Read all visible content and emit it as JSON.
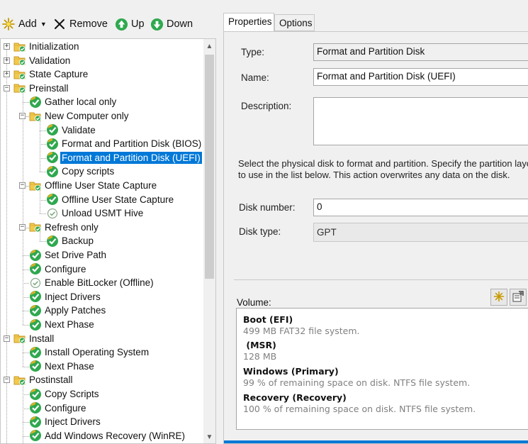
{
  "toolbar": {
    "add_label": "Add",
    "remove_label": "Remove",
    "up_label": "Up",
    "down_label": "Down"
  },
  "tree": {
    "items": [
      {
        "label": "Initialization",
        "icon": "folder-icon"
      },
      {
        "label": "Validation",
        "icon": "folder-icon"
      },
      {
        "label": "State Capture",
        "icon": "folder-icon"
      },
      {
        "label": "Preinstall",
        "icon": "folder-icon"
      },
      {
        "label": "Gather local only",
        "icon": "check-icon"
      },
      {
        "label": "New Computer only",
        "icon": "folder-icon"
      },
      {
        "label": "Validate",
        "icon": "check-icon"
      },
      {
        "label": "Format and Partition Disk (BIOS)",
        "icon": "check-icon"
      },
      {
        "label": "Format and Partition Disk (UEFI)",
        "icon": "check-icon",
        "selected": true
      },
      {
        "label": "Copy scripts",
        "icon": "check-icon"
      },
      {
        "label": "Offline User State Capture",
        "icon": "folder-icon"
      },
      {
        "label": "Offline User State Capture",
        "icon": "check-icon"
      },
      {
        "label": "Unload USMT Hive",
        "icon": "disabled-check-icon"
      },
      {
        "label": "Refresh only",
        "icon": "folder-icon"
      },
      {
        "label": "Backup",
        "icon": "check-icon"
      },
      {
        "label": "Set Drive Path",
        "icon": "check-icon"
      },
      {
        "label": "Configure",
        "icon": "check-icon"
      },
      {
        "label": "Enable BitLocker (Offline)",
        "icon": "disabled-check-icon"
      },
      {
        "label": "Inject Drivers",
        "icon": "check-icon"
      },
      {
        "label": "Apply Patches",
        "icon": "check-icon"
      },
      {
        "label": "Next Phase",
        "icon": "check-icon"
      },
      {
        "label": "Install",
        "icon": "folder-icon"
      },
      {
        "label": "Install Operating System",
        "icon": "check-icon"
      },
      {
        "label": "Next Phase",
        "icon": "check-icon"
      },
      {
        "label": "Postinstall",
        "icon": "folder-icon"
      },
      {
        "label": "Copy Scripts",
        "icon": "check-icon"
      },
      {
        "label": "Configure",
        "icon": "check-icon"
      },
      {
        "label": "Inject Drivers",
        "icon": "check-icon"
      },
      {
        "label": "Add Windows Recovery (WinRE)",
        "icon": "check-icon"
      }
    ]
  },
  "tabs": [
    {
      "label": "Properties",
      "active": true
    },
    {
      "label": "Options",
      "active": false
    }
  ],
  "properties": {
    "type_label": "Type:",
    "type_value": "Format and Partition Disk",
    "name_label": "Name:",
    "name_value": "Format and Partition Disk (UEFI)",
    "description_label": "Description:",
    "description_value": "",
    "info_line1": "Select the physical disk to format and partition.  Specify the partition layout",
    "info_line2": "to use in the list below. This action overwrites any data on the disk.",
    "disk_number_label": "Disk number:",
    "disk_number_value": "0",
    "disk_type_label": "Disk type:",
    "disk_type_value": "GPT",
    "volume_label": "Volume:"
  },
  "volumes": [
    {
      "name": "Boot (EFI)",
      "desc": "499 MB FAT32 file system."
    },
    {
      "name": " (MSR)",
      "desc": "128 MB"
    },
    {
      "name": "Windows (Primary)",
      "desc": "99 % of remaining space on disk. NTFS file system."
    },
    {
      "name": "Recovery (Recovery)",
      "desc": "100 % of remaining space on disk. NTFS file system."
    }
  ],
  "colors": {
    "selection": "#0078d7",
    "check_green": "#27a22a",
    "folder_yellow": "#f2c94c"
  }
}
